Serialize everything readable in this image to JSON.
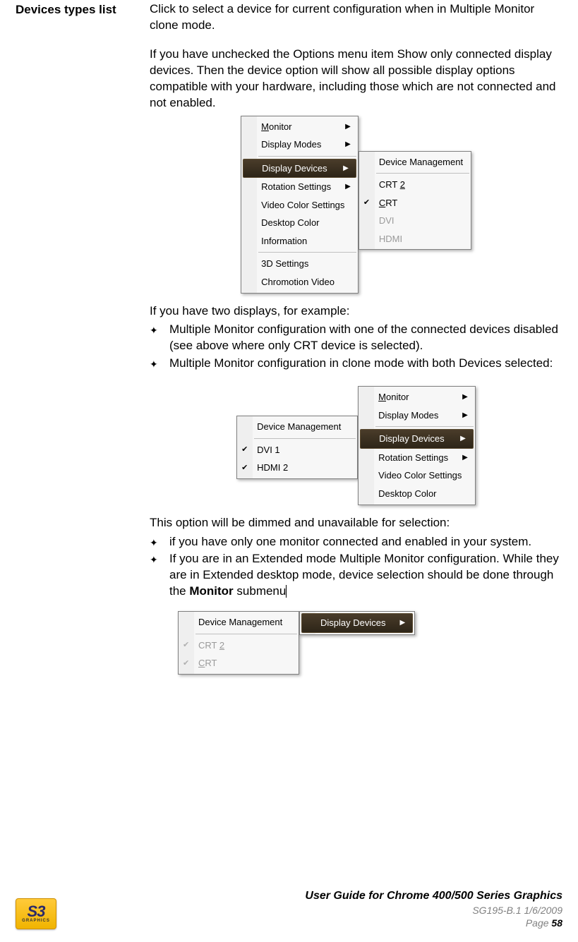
{
  "section": {
    "label": "Devices types list",
    "para1": "Click to select a device for current configuration when in Multiple Monitor clone mode.",
    "para2": "If you have unchecked the Options menu item Show only connected display devices. Then the device option will show all possible display options compatible with your hardware, including those which are not connected and not enabled.",
    "para3": "If you have two displays, for  example:",
    "bullets1": [
      "Multiple Monitor configuration with one of the connected devices disabled (see above where only CRT device is selected).",
      "Multiple Monitor configuration in clone mode with both Devices selected:"
    ],
    "para4": "This option will be dimmed and unavailable for selection:",
    "bullets2": [
      "if you have only one monitor connected and enabled in your system.",
      "If you are in an Extended mode Multiple Monitor configuration. While they are in Extended desktop mode, device selection should be done through the "
    ],
    "monitor_bold": "Monitor",
    "submenu_text": " submenu"
  },
  "menu1": {
    "left": {
      "items": [
        {
          "label": "Monitor",
          "arrow": true,
          "underline_first": true
        },
        {
          "label": "Display Modes",
          "arrow": true
        }
      ],
      "items_mid": [
        {
          "label": "Display Devices",
          "arrow": true,
          "hl": true
        },
        {
          "label": "Rotation Settings",
          "arrow": true
        },
        {
          "label": "Video Color Settings"
        },
        {
          "label": "Desktop Color"
        },
        {
          "label": "Information"
        }
      ],
      "items_bot": [
        {
          "label": "3D Settings"
        },
        {
          "label": "Chromotion Video"
        }
      ]
    },
    "right": {
      "header": "Device Management",
      "items": [
        {
          "label": "CRT 2",
          "under": "2"
        },
        {
          "label": "CRT",
          "under": "C",
          "check": true
        },
        {
          "label": "DVI",
          "disabled": true
        },
        {
          "label": "HDMI",
          "disabled": true
        }
      ]
    }
  },
  "menu2": {
    "left": {
      "header": "Device Management",
      "items": [
        {
          "label": "DVI 1",
          "check": true
        },
        {
          "label": "HDMI 2",
          "check": true
        }
      ]
    },
    "right": {
      "items_top": [
        {
          "label": "Monitor",
          "arrow": true,
          "underline_first": true
        },
        {
          "label": "Display Modes",
          "arrow": true
        }
      ],
      "items_mid": [
        {
          "label": "Display Devices",
          "arrow": true,
          "hl": true
        },
        {
          "label": "Rotation Settings",
          "arrow": true
        },
        {
          "label": "Video Color Settings"
        },
        {
          "label": "Desktop Color"
        }
      ]
    }
  },
  "menu3": {
    "left": {
      "header": "Device Management",
      "items": [
        {
          "label": "CRT 2",
          "disabled": true,
          "check": true,
          "under": "2"
        },
        {
          "label": "CRT",
          "disabled": true,
          "check": true,
          "under": "C"
        }
      ]
    },
    "right": {
      "label": "Display Devices",
      "arrow": true,
      "hl": true
    }
  },
  "footer": {
    "logo_main": "S3",
    "logo_sub": "GRAPHICS",
    "title": "User Guide for Chrome 400/500 Series Graphics",
    "meta": "SG195-B.1   1/6/2009",
    "page_label": "Page ",
    "page_num": "58"
  }
}
